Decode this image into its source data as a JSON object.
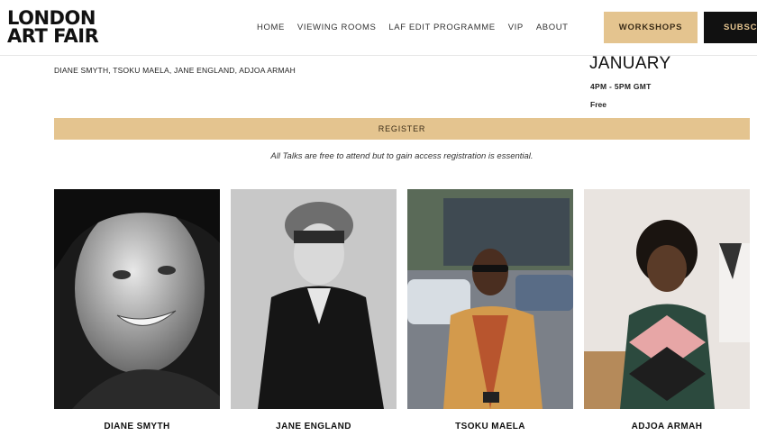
{
  "header": {
    "logo_line1": "LONDON",
    "logo_line2": "ART FAIR",
    "nav": [
      "HOME",
      "VIEWING ROOMS",
      "LAF EDIT PROGRAMME",
      "VIP",
      "ABOUT"
    ],
    "workshops_label": "WORKSHOPS",
    "subscribe_label": "SUBSCR"
  },
  "event": {
    "speakers": "DIANE SMYTH, TSOKU MAELA, JANE ENGLAND, ADJOA ARMAH",
    "month": "JANUARY",
    "time": "4PM - 5PM GMT",
    "price": "Free",
    "register_label": "REGISTER",
    "note": "All Talks are free to attend but to gain access registration is essential."
  },
  "people": [
    {
      "name": "DIANE SMYTH"
    },
    {
      "name": "JANE ENGLAND"
    },
    {
      "name": "TSOKU MAELA"
    },
    {
      "name": "ADJOA ARMAH"
    }
  ],
  "colors": {
    "accent": "#e4c48f",
    "dark": "#111111"
  }
}
